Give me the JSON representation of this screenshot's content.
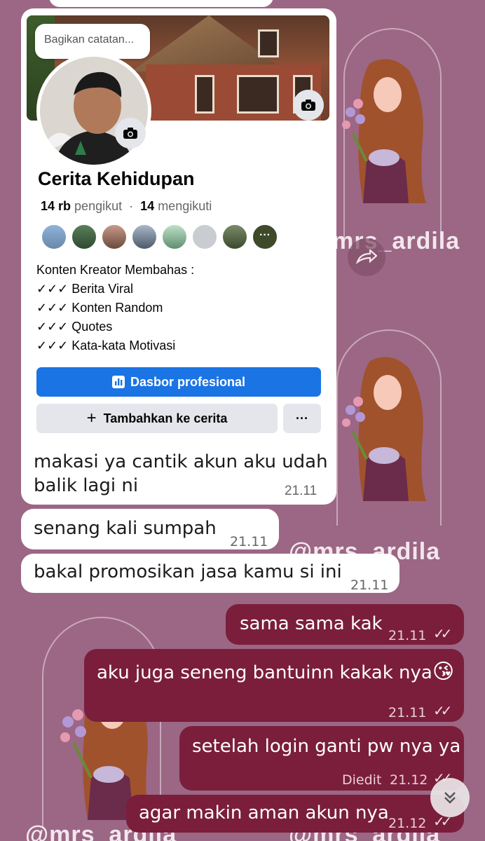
{
  "watermark": "@mrs_ardila",
  "profile_card": {
    "note_placeholder": "Bagikan catatan...",
    "name": "Cerita Kehidupan",
    "followers_count": "14 rb",
    "followers_label": "pengikut",
    "separator": "·",
    "following_count": "14",
    "following_label": "mengikuti",
    "bio_heading": "Konten Kreator Membahas :",
    "bio_items": [
      "✓✓✓ Berita Viral",
      "✓✓✓ Konten Random",
      "✓✓✓ Quotes",
      "✓✓✓ Kata-kata Motivasi"
    ],
    "dashboard_button": "Dasbor profesional",
    "add_story_button": "Tambahkan ke cerita",
    "more_button": "···"
  },
  "messages": {
    "in": [
      {
        "text_line1": "makasi ya cantik akun aku udah",
        "text_line2": "balik lagi ni",
        "time": "21.11"
      },
      {
        "text": "senang kali sumpah",
        "time": "21.11"
      },
      {
        "text": "bakal promosikan jasa kamu si ini",
        "time": "21.11"
      }
    ],
    "out": [
      {
        "text": "sama sama kak",
        "time": "21.11"
      },
      {
        "text": "aku juga seneng bantuinn kakak nya",
        "emoji": "😘",
        "time": "21.11"
      },
      {
        "text": "setelah login ganti pw nya ya",
        "edited": "Diedit",
        "time": "21.12"
      },
      {
        "text": "agar makin aman akun nya",
        "time": "21.12"
      }
    ]
  },
  "colors": {
    "background": "#9b6784",
    "outgoing_bubble": "#7a1e3c",
    "incoming_bubble": "#ffffff",
    "facebook_blue": "#1b74e4"
  }
}
